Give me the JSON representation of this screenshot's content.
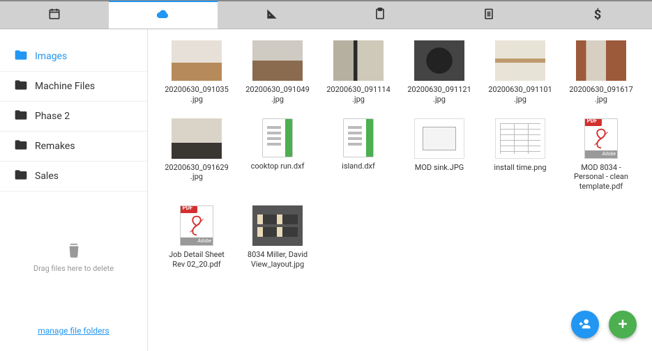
{
  "tabs": [
    {
      "icon": "calendar"
    },
    {
      "icon": "cloud",
      "active": true
    },
    {
      "icon": "ruler"
    },
    {
      "icon": "clipboard"
    },
    {
      "icon": "document"
    },
    {
      "icon": "dollar"
    }
  ],
  "sidebar": {
    "folders": [
      {
        "label": "Images",
        "active": true
      },
      {
        "label": "Machine Files"
      },
      {
        "label": "Phase 2"
      },
      {
        "label": "Remakes"
      },
      {
        "label": "Sales"
      }
    ],
    "drop_label": "Drag files here to delete",
    "manage_label": "manage file folders"
  },
  "files": [
    {
      "name": "20200630_091035.jpg",
      "thumb": "photo1"
    },
    {
      "name": "20200630_091049.jpg",
      "thumb": "photo2"
    },
    {
      "name": "20200630_091114.jpg",
      "thumb": "photo3"
    },
    {
      "name": "20200630_091121.jpg",
      "thumb": "photo4"
    },
    {
      "name": "20200630_091101.jpg",
      "thumb": "photo5"
    },
    {
      "name": "20200630_091617.jpg",
      "thumb": "photo6"
    },
    {
      "name": "20200630_091629.jpg",
      "thumb": "photo7"
    },
    {
      "name": "cooktop run.dxf",
      "thumb": "dxf"
    },
    {
      "name": "island.dxf",
      "thumb": "dxf"
    },
    {
      "name": "MOD sink.JPG",
      "thumb": "sink"
    },
    {
      "name": "install time.png",
      "thumb": "table"
    },
    {
      "name": "MOD 8034 - Personal - clean template.pdf",
      "thumb": "pdf"
    },
    {
      "name": "Job Detail Sheet Rev 02_20.pdf",
      "thumb": "pdf"
    },
    {
      "name": "8034 Miller, David View_layout.jpg",
      "thumb": "layout"
    }
  ],
  "fab": {
    "share_icon": "person-add",
    "add_icon": "plus"
  },
  "pdf_badge": "PDF",
  "adobe_label": "Adobe"
}
